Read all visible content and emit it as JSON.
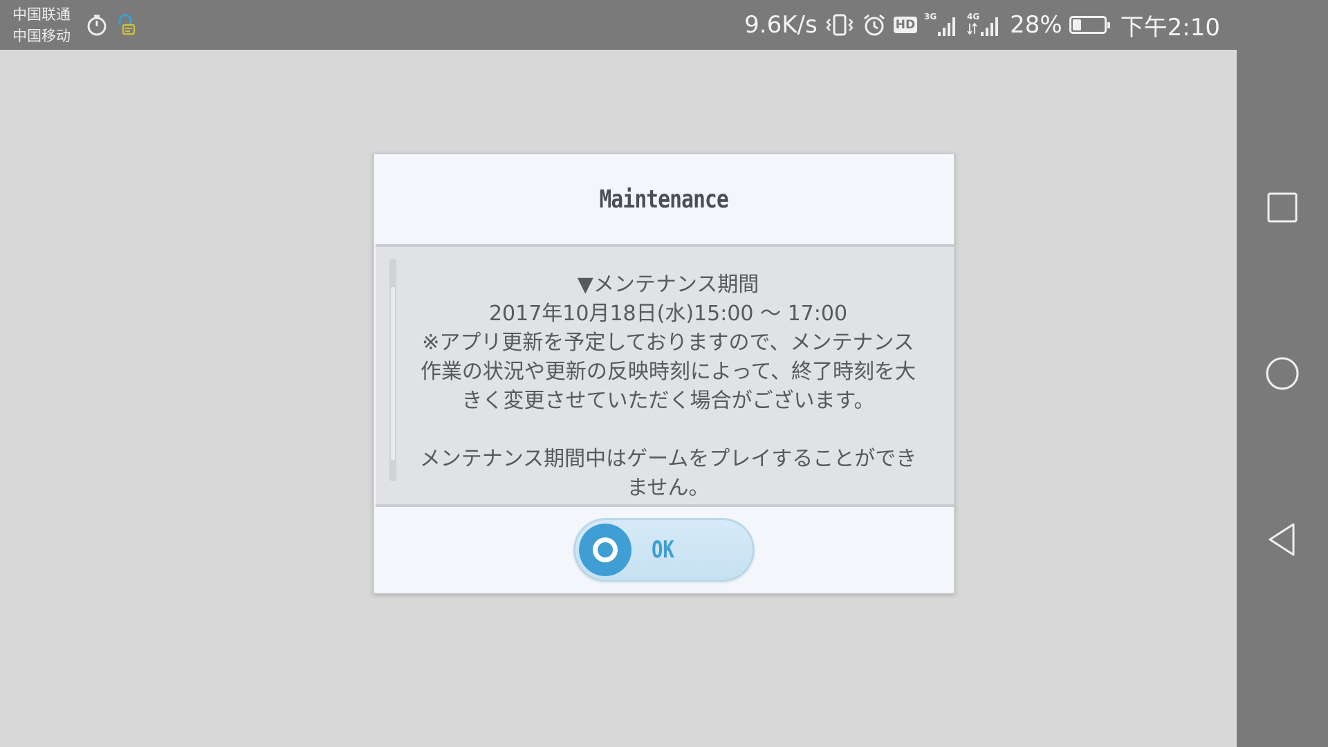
{
  "status_bar": {
    "carrier_1": "中国联通",
    "carrier_2": "中国移动",
    "left_icons": [
      "timer-icon",
      "lock-message-icon"
    ],
    "net_speed": "9.6K/s",
    "hd_label": "HD",
    "signal_1_type": "3G",
    "signal_2_type": "4G",
    "battery_percent": "28%",
    "battery_level": 0.28,
    "time": "下午2:10",
    "right_icons": [
      "vibrate-icon",
      "alarm-icon",
      "hd-icon",
      "signal-3g-icon",
      "signal-4g-icon",
      "battery-icon"
    ]
  },
  "dialog": {
    "title": "Maintenance",
    "body": {
      "heading": "▼メンテナンス期間",
      "period": "2017年10月18日(水)15:00 〜 17:00",
      "note_line_1": "※アプリ更新を予定しておりますので、メンテナンス",
      "note_line_2": "作業の状況や更新の反映時刻によって、終了時刻を大",
      "note_line_3": "きく変更させていただく場合がございます。",
      "info_line_1": "メンテナンス期間中はゲームをプレイすることができ",
      "info_line_2": "ません。"
    },
    "ok_label": "OK"
  },
  "nav_bar": {
    "buttons": [
      "recents-square-icon",
      "home-circle-icon",
      "back-triangle-icon"
    ]
  },
  "colors": {
    "status_bg": "#7a7a7a",
    "game_bg": "#d8d8d8",
    "dialog_bg": "#f3f6fa",
    "body_bg": "#e0e2e5",
    "accent_blue": "#3f9ed4",
    "text": "#56595e"
  }
}
